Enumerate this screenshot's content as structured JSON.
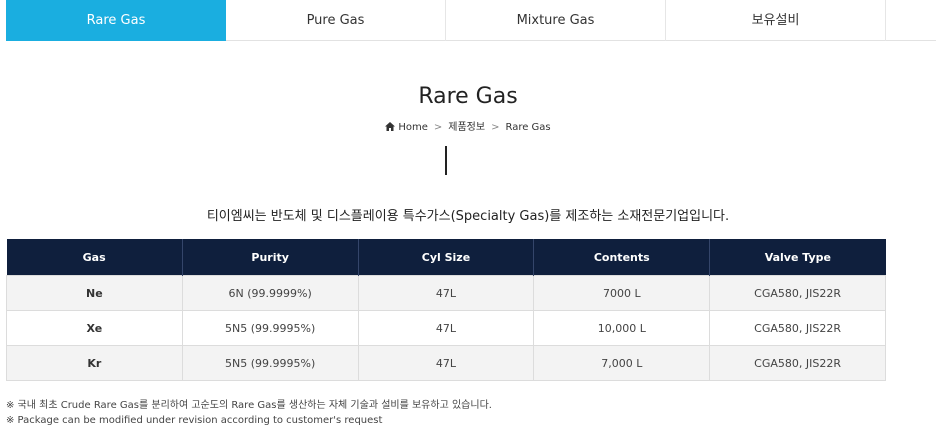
{
  "tabs": [
    {
      "label": "Rare Gas",
      "active": true
    },
    {
      "label": "Pure Gas",
      "active": false
    },
    {
      "label": "Mixture Gas",
      "active": false
    },
    {
      "label": "보유설비",
      "active": false
    }
  ],
  "page_title": "Rare Gas",
  "breadcrumb": {
    "home": "Home",
    "sep": ">",
    "level1": "제품정보",
    "level2": "Rare Gas"
  },
  "intro": "티이엠씨는 반도체 및 디스플레이용 특수가스(Specialty Gas)를 제조하는 소재전문기업입니다.",
  "table": {
    "headers": [
      "Gas",
      "Purity",
      "Cyl Size",
      "Contents",
      "Valve Type"
    ],
    "rows": [
      [
        "Ne",
        "6N (99.9999%)",
        "47L",
        "7000 L",
        "CGA580, JIS22R"
      ],
      [
        "Xe",
        "5N5 (99.9995%)",
        "47L",
        "10,000 L",
        "CGA580, JIS22R"
      ],
      [
        "Kr",
        "5N5 (99.9995%)",
        "47L",
        "7,000 L",
        "CGA580, JIS22R"
      ]
    ]
  },
  "notes": [
    "※ 국내 최초 Crude Rare Gas를 분리하여 고순도의 Rare Gas를 생산하는 자체 기술과 설비를 보유하고 있습니다.",
    "※ Package can be modified under revision according to customer's request"
  ],
  "colors": {
    "accent": "#1aaee0",
    "table_header": "#0f1f3d"
  },
  "icons": {
    "home": "home-icon"
  }
}
